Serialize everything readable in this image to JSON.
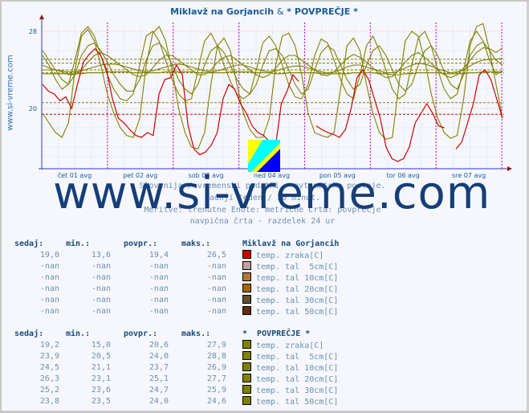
{
  "title": {
    "part1": "Miklavž na Gorjancih",
    "amp": "&",
    "part2": "* POVPREČJE *"
  },
  "side_label": "www.si-vreme.com",
  "watermark": "www.si-vreme.com",
  "info_lines": [
    "Slovenija / vremenski podatki - avtomatske postaje.",
    "zadnji teden / 30 minut.",
    "Meritve: trenutne  Enote: metrične  Črta: povprečje",
    "navpična črta - razdelek 24 ur"
  ],
  "colors": {
    "station_air": "#cc0000",
    "avg": "#808000",
    "axis": "#3333cc",
    "day_line": "#cc00cc"
  },
  "chart_data": {
    "type": "line",
    "title": "Miklavž na Gorjancih & * POVPREČJE *",
    "xlabel": "",
    "ylabel": "",
    "x_tick_labels": [
      "čet 01 avg",
      "pet 02 avg",
      "sob 03 avg",
      "ned 04 avg",
      "pon 05 avg",
      "tor 06 avg",
      "sre 07 avg"
    ],
    "y_tick_labels": [
      "20",
      "28"
    ],
    "ylim": [
      14.5,
      29
    ],
    "days": 7,
    "grid": true,
    "series": [
      {
        "name": "Miklavž na Gorjancih temp. zraka[C]",
        "color": "#cc0000",
        "avg_line": 19.4,
        "values": [
          22.5,
          21.8,
          21.5,
          20.8,
          21.2,
          20.0,
          22.5,
          24.8,
          25.6,
          26.2,
          25.5,
          24.0,
          21.0,
          19.0,
          18.5,
          17.8,
          17.2,
          17.0,
          17.5,
          17.2,
          21.5,
          23.0,
          23.2,
          24.5,
          23.5,
          18.2,
          15.8,
          15.2,
          15.5,
          16.2,
          17.5,
          21.0,
          22.5,
          22.0,
          20.5,
          19.5,
          18.2,
          17.5,
          17.2,
          16.5,
          16.0,
          20.5,
          21.8,
          23.5,
          22.8,
          null,
          null,
          18.2,
          17.8,
          17.5,
          17.3,
          17.0,
          17.8,
          20.0,
          23.2,
          24.0,
          23.0,
          21.0,
          19.0,
          16.0,
          14.8,
          14.5,
          14.8,
          16.0,
          18.5,
          19.5,
          20.5,
          19.5,
          18.2,
          18.0,
          null,
          15.8,
          16.5,
          18.5,
          20.5,
          23.5,
          24.0,
          23.0,
          21.0,
          19.0
        ]
      },
      {
        "name": "* POVPREČJE * temp. zraka[C]",
        "color": "#808000",
        "avg_line": 20.6,
        "values": [
          19.5,
          18.5,
          17.5,
          17.0,
          18.5,
          24.0,
          27.5,
          28.2,
          27.0,
          24.5,
          21.5,
          19.5,
          18.0,
          17.2,
          17.0,
          19.0,
          24.5,
          27.8,
          28.5,
          27.0,
          24.0,
          20.0,
          17.5,
          16.0,
          15.8,
          17.5,
          22.5,
          26.5,
          27.3,
          26.0,
          22.5,
          19.5,
          17.8,
          17.0,
          17.0,
          19.0,
          24.5,
          27.5,
          27.8,
          26.5,
          23.5,
          19.5,
          17.5,
          17.2,
          17.0,
          17.5,
          22.0,
          26.5,
          27.3,
          26.0,
          22.5,
          19.5,
          17.5,
          16.8,
          17.0,
          22.5,
          27.0,
          28.0,
          27.5,
          25.0,
          21.5,
          19.0,
          17.5,
          16.9,
          17.2,
          21.0,
          26.5,
          28.5,
          28.8,
          26.0,
          22.5,
          19.0
        ]
      },
      {
        "name": "* POVPREČJE * temp. tal 5cm[C]",
        "color": "#808000",
        "avg_line": 24.0,
        "values": [
          25.5,
          24.5,
          23.0,
          22.0,
          22.5,
          25.0,
          27.8,
          28.5,
          27.5,
          25.5,
          23.5,
          22.0,
          21.0,
          20.8,
          21.5,
          24.5,
          27.5,
          28.0,
          27.0,
          25.0,
          23.0,
          21.5,
          20.8,
          21.0,
          24.0,
          27.0,
          27.8,
          26.5,
          24.5,
          22.8,
          21.5,
          21.0,
          21.5,
          24.0,
          26.8,
          27.5,
          26.5,
          24.5,
          22.5,
          21.2,
          21.0,
          22.5,
          25.5,
          27.2,
          26.8,
          25.0,
          23.0,
          21.5,
          21.0,
          23.5,
          26.5,
          27.5,
          26.0,
          24.0,
          22.0,
          21.0,
          21.5,
          24.5,
          27.3,
          28.0,
          26.5,
          24.0,
          22.0,
          21.0,
          21.5,
          24.0,
          27.0,
          28.0,
          27.0,
          25.0,
          23.5,
          23.9
        ]
      },
      {
        "name": "* POVPREČJE * temp. tal 10cm[C]",
        "color": "#808000",
        "avg_line": 23.7,
        "values": [
          26.0,
          25.0,
          24.0,
          23.0,
          22.5,
          23.5,
          25.5,
          26.5,
          26.8,
          26.0,
          24.8,
          23.5,
          22.5,
          21.8,
          21.8,
          23.0,
          25.0,
          26.5,
          26.8,
          26.0,
          24.5,
          23.0,
          22.0,
          21.5,
          22.5,
          24.5,
          26.0,
          26.5,
          25.8,
          24.5,
          23.0,
          22.0,
          21.5,
          22.5,
          24.5,
          26.0,
          26.2,
          25.5,
          24.0,
          22.5,
          21.5,
          22.0,
          24.0,
          25.8,
          26.5,
          26.0,
          24.5,
          23.0,
          22.0,
          22.5,
          24.5,
          26.0,
          26.5,
          25.5,
          24.0,
          22.5,
          21.8,
          22.5,
          24.5,
          26.0,
          26.5,
          25.5,
          23.8,
          22.5,
          22.0,
          23.5,
          25.5,
          26.5,
          26.9,
          26.0,
          25.0,
          24.5
        ]
      },
      {
        "name": "* POVPREČJE * temp. tal 20cm[C]",
        "color": "#808000",
        "avg_line": 25.1,
        "values": [
          24.5,
          24.2,
          24.0,
          23.8,
          23.5,
          23.5,
          24.0,
          24.8,
          25.5,
          25.8,
          25.5,
          25.0,
          24.5,
          24.0,
          23.5,
          23.3,
          23.5,
          24.2,
          25.0,
          25.5,
          25.5,
          25.0,
          24.5,
          24.0,
          23.5,
          23.5,
          24.0,
          24.8,
          25.3,
          25.5,
          25.0,
          24.5,
          24.0,
          23.5,
          23.2,
          23.5,
          24.2,
          25.0,
          25.5,
          25.5,
          25.0,
          24.5,
          24.0,
          23.5,
          23.4,
          23.8,
          24.5,
          25.2,
          25.6,
          25.3,
          24.8,
          24.2,
          23.6,
          23.2,
          23.3,
          24.0,
          24.8,
          25.5,
          25.8,
          25.3,
          24.7,
          24.0,
          23.5,
          23.2,
          23.5,
          24.2,
          25.0,
          25.8,
          26.3,
          26.2,
          25.8,
          26.3
        ]
      },
      {
        "name": "* POVPREČJE * temp. tal 30cm[C]",
        "color": "#808000",
        "avg_line": 24.7,
        "values": [
          24.0,
          24.0,
          24.0,
          23.9,
          23.8,
          23.8,
          23.9,
          24.1,
          24.3,
          24.5,
          24.6,
          24.6,
          24.5,
          24.3,
          24.1,
          23.9,
          23.8,
          23.9,
          24.1,
          24.3,
          24.5,
          24.6,
          24.5,
          24.3,
          24.1,
          23.9,
          23.8,
          23.9,
          24.1,
          24.3,
          24.5,
          24.5,
          24.3,
          24.1,
          23.9,
          23.8,
          23.9,
          24.1,
          24.3,
          24.4,
          24.4,
          24.2,
          24.0,
          23.8,
          23.7,
          23.8,
          24.0,
          24.3,
          24.5,
          24.5,
          24.3,
          24.1,
          23.9,
          23.7,
          23.7,
          23.9,
          24.2,
          24.5,
          24.7,
          24.6,
          24.4,
          24.1,
          23.9,
          23.7,
          23.8,
          24.0,
          24.4,
          24.8,
          25.0,
          25.1,
          25.1,
          25.2
        ]
      },
      {
        "name": "* POVPREČJE * temp. tal 50cm[C]",
        "color": "#808000",
        "avg_line": 24.0,
        "values": [
          23.6,
          23.6,
          23.6,
          23.6,
          23.6,
          23.6,
          23.6,
          23.7,
          23.7,
          23.7,
          23.8,
          23.8,
          23.8,
          23.8,
          23.7,
          23.7,
          23.7,
          23.7,
          23.7,
          23.8,
          23.8,
          23.8,
          23.8,
          23.8,
          23.7,
          23.7,
          23.7,
          23.7,
          23.7,
          23.8,
          23.8,
          23.8,
          23.8,
          23.7,
          23.7,
          23.7,
          23.6,
          23.6,
          23.7,
          23.7,
          23.7,
          23.7,
          23.7,
          23.6,
          23.6,
          23.6,
          23.6,
          23.6,
          23.7,
          23.7,
          23.7,
          23.7,
          23.6,
          23.6,
          23.5,
          23.5,
          23.6,
          23.6,
          23.7,
          23.7,
          23.7,
          23.7,
          23.6,
          23.6,
          23.6,
          23.6,
          23.7,
          23.7,
          23.8,
          23.8,
          23.8,
          23.8
        ]
      }
    ]
  },
  "table1": {
    "headers": [
      "sedaj:",
      "min.:",
      "povpr.:",
      "maks.:"
    ],
    "station": "Miklavž na Gorjancih",
    "rows": [
      {
        "now": "19,0",
        "min": "13,6",
        "avg": "19,4",
        "max": "26,5",
        "label": "temp. zraka[C]",
        "color": "#cc0000"
      },
      {
        "now": "-nan",
        "min": "-nan",
        "avg": "-nan",
        "max": "-nan",
        "label": "temp. tal  5cm[C]",
        "color": "#c0a0a0"
      },
      {
        "now": "-nan",
        "min": "-nan",
        "avg": "-nan",
        "max": "-nan",
        "label": "temp. tal 10cm[C]",
        "color": "#b07840"
      },
      {
        "now": "-nan",
        "min": "-nan",
        "avg": "-nan",
        "max": "-nan",
        "label": "temp. tal 20cm[C]",
        "color": "#a06800"
      },
      {
        "now": "-nan",
        "min": "-nan",
        "avg": "-nan",
        "max": "-nan",
        "label": "temp. tal 30cm[C]",
        "color": "#605030"
      },
      {
        "now": "-nan",
        "min": "-nan",
        "avg": "-nan",
        "max": "-nan",
        "label": "temp. tal 50cm[C]",
        "color": "#603010"
      }
    ]
  },
  "table2": {
    "headers": [
      "sedaj:",
      "min.:",
      "povpr.:",
      "maks.:"
    ],
    "station": "*  POVPREČJE *",
    "rows": [
      {
        "now": "19,2",
        "min": "15,0",
        "avg": "20,6",
        "max": "27,9",
        "label": "temp. zraka[C]",
        "color": "#808000"
      },
      {
        "now": "23,9",
        "min": "20,5",
        "avg": "24,0",
        "max": "28,8",
        "label": "temp. tal  5cm[C]",
        "color": "#808000"
      },
      {
        "now": "24,5",
        "min": "21,1",
        "avg": "23,7",
        "max": "26,9",
        "label": "temp. tal 10cm[C]",
        "color": "#808000"
      },
      {
        "now": "26,3",
        "min": "23,1",
        "avg": "25,1",
        "max": "27,7",
        "label": "temp. tal 20cm[C]",
        "color": "#808000"
      },
      {
        "now": "25,2",
        "min": "23,6",
        "avg": "24,7",
        "max": "25,9",
        "label": "temp. tal 30cm[C]",
        "color": "#808000"
      },
      {
        "now": "23,8",
        "min": "23,5",
        "avg": "24,0",
        "max": "24,6",
        "label": "temp. tal 50cm[C]",
        "color": "#808000"
      }
    ]
  }
}
